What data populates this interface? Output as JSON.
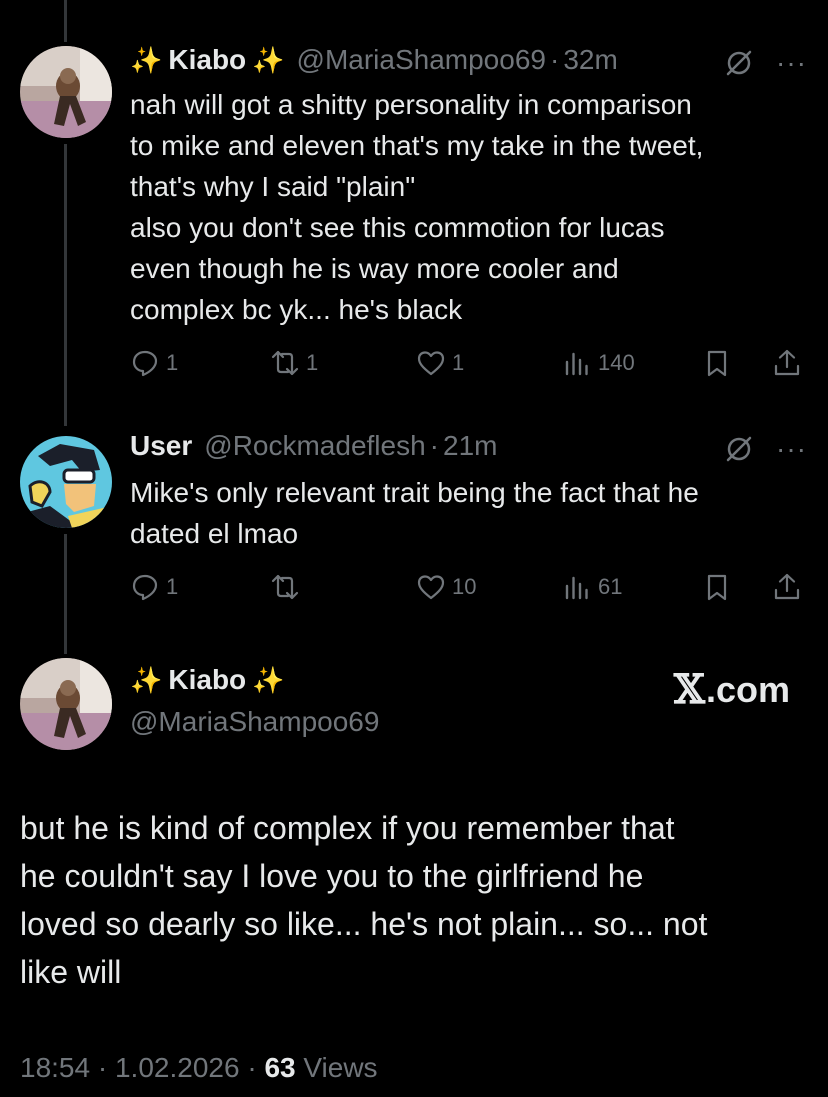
{
  "tweet1": {
    "sparkle_left": "✨",
    "name": "Kiabo",
    "sparkle_right": "✨",
    "handle": "@MariaShampoo69",
    "dot": "·",
    "time": "32m",
    "more": "···",
    "lines": [
      "nah will got a shitty personality in comparison",
      "to mike and eleven that's my take in the tweet,",
      "that's why I said \"plain\"",
      "also you don't see this commotion for lucas",
      "even though he is way more cooler and",
      "complex bc yk... he's black"
    ],
    "replies": "1",
    "reposts": "1",
    "likes": "1",
    "views": "140"
  },
  "tweet2": {
    "name": "User",
    "handle": "@Rockmadeflesh",
    "dot": "·",
    "time": "21m",
    "more": "···",
    "lines": [
      "Mike's only relevant trait being the fact that he",
      "dated el lmao"
    ],
    "replies": "1",
    "reposts": "",
    "likes": "10",
    "views": "61"
  },
  "main": {
    "sparkle_left": "✨",
    "name": "Kiabo",
    "sparkle_right": "✨",
    "handle": "@MariaShampoo69",
    "watermark_x": "𝕏",
    "watermark_com": ".com",
    "lines": [
      "but he is kind of complex if you remember that",
      "he couldn't say I love you to the girlfriend he",
      "loved so dearly so like... he's not plain... so... not",
      "like will"
    ],
    "time": "18:54",
    "dot": "·",
    "date": "1.02.2026",
    "views_count": "63",
    "views_label": "Views"
  }
}
